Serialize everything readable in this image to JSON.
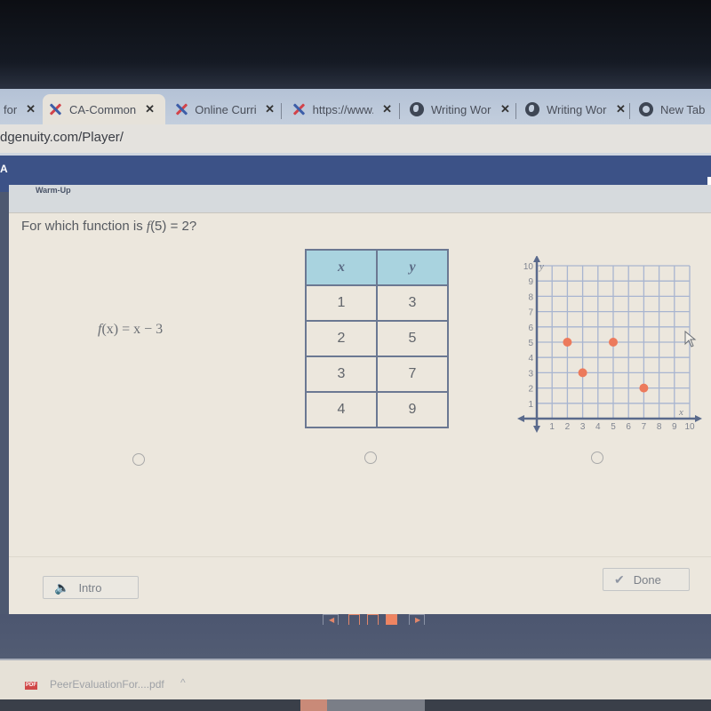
{
  "browser": {
    "tabs": [
      {
        "title": "for",
        "icon": "blank",
        "active": false
      },
      {
        "title": "CA-Common",
        "icon": "edgenuity-x-icon",
        "active": true
      },
      {
        "title": "Online Curric",
        "icon": "edgenuity-x-icon",
        "active": false
      },
      {
        "title": "https://www.e",
        "icon": "edgenuity-x-icon",
        "active": false
      },
      {
        "title": "Writing Work",
        "icon": "globe-icon",
        "active": false
      },
      {
        "title": "Writing Work",
        "icon": "globe-icon",
        "active": false
      },
      {
        "title": "New Tab",
        "icon": "chrome-icon",
        "active": false
      }
    ],
    "close_glyph": "✕",
    "url": "dgenuity.com/Player/"
  },
  "appbar": {
    "corner_label": "A"
  },
  "activity": {
    "section_label": "Warm-Up",
    "question_prefix": "For which function is ",
    "question_func": "f",
    "question_suffix": "(5) = 2?",
    "choices": [
      {
        "type": "equation",
        "f": "f",
        "rest": "(x) = x − 3"
      },
      {
        "type": "table",
        "headers": [
          "x",
          "y"
        ],
        "rows": [
          [
            "1",
            "3"
          ],
          [
            "2",
            "5"
          ],
          [
            "3",
            "7"
          ],
          [
            "4",
            "9"
          ]
        ]
      },
      {
        "type": "graph"
      }
    ]
  },
  "chart_data": {
    "type": "scatter",
    "title": "",
    "xlabel": "x",
    "ylabel": "y",
    "xlim": [
      0,
      10
    ],
    "ylim": [
      0,
      10
    ],
    "x_ticks": [
      "1",
      "2",
      "3",
      "4",
      "5",
      "6",
      "7",
      "8",
      "9",
      "10"
    ],
    "y_ticks": [
      "1",
      "2",
      "3",
      "4",
      "5",
      "6",
      "7",
      "8",
      "9",
      "10"
    ],
    "grid": true,
    "points": [
      {
        "x": 2,
        "y": 5
      },
      {
        "x": 3,
        "y": 3
      },
      {
        "x": 5,
        "y": 5
      },
      {
        "x": 7,
        "y": 2
      }
    ],
    "point_color": "#ec7a5c",
    "grid_color": "#a8b5d0",
    "axis_color": "#5a6a8c"
  },
  "buttons": {
    "intro": "Intro",
    "done": "Done"
  },
  "pager": {
    "prev": "◀",
    "next": "▶",
    "pages": 3,
    "current": 3
  },
  "download": {
    "file": "PeerEvaluationFor....pdf",
    "badge": "PDF",
    "chevron": "^"
  }
}
